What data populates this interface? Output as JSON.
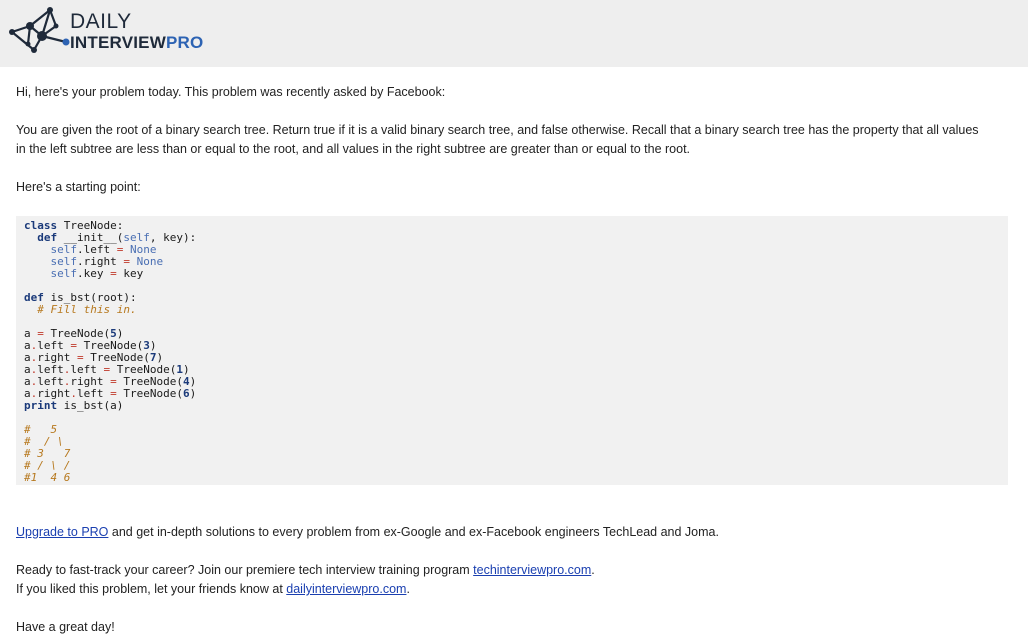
{
  "logo": {
    "line1": "DAILY",
    "line2_a": "INTERVIEW",
    "line2_b": "PRO"
  },
  "email": {
    "greeting": "Hi, here's your problem today. This problem was recently asked by Facebook:",
    "problem": "You are given the root of a binary search tree. Return true if it is a valid binary search tree, and false otherwise. Recall that a binary search tree has the property that all values in the left subtree are less than or equal to the root, and all values in the right subtree are greater than or equal to the root.",
    "starting_point": "Here's a starting point:",
    "upgrade_link": "Upgrade to PRO",
    "upgrade_text": " and get in-depth solutions to every problem from ex-Google and ex-Facebook engineers TechLead and Joma.",
    "ready_text": "Ready to fast-track your career? Join our premiere tech interview training program ",
    "ready_link": "techinterviewpro.com",
    "ready_end": ".",
    "liked_text": "If you liked this problem, let your friends know at ",
    "liked_link": "dailyinterviewpro.com",
    "liked_end": ".",
    "signoff": "Have a great day!"
  },
  "code": {
    "l1_kw": "class",
    "l1_rest": " TreeNode:",
    "l2_kw": "def",
    "l2_rest_a": " __init__(",
    "l2_self": "self",
    "l2_rest_b": ", key):",
    "l3_self": "self",
    "l3_a": ".left ",
    "l3_op": "=",
    "l3_none": " None",
    "l4_self": "self",
    "l4_a": ".right ",
    "l4_op": "=",
    "l4_none": " None",
    "l5_self": "self",
    "l5_a": ".key ",
    "l5_op": "=",
    "l5_b": " key",
    "l6_kw": "def",
    "l6_rest": " is_bst(root):",
    "l7_cm": "# Fill this in.",
    "l8_a": "a ",
    "l8_op": "=",
    "l8_b": " TreeNode(",
    "l8_n": "5",
    "l8_c": ")",
    "l9_a": "a",
    "l9_op1": ".",
    "l9_b": "left ",
    "l9_op": "=",
    "l9_c": " TreeNode(",
    "l9_n": "3",
    "l9_d": ")",
    "l10_a": "a",
    "l10_op1": ".",
    "l10_b": "right ",
    "l10_op": "=",
    "l10_c": " TreeNode(",
    "l10_n": "7",
    "l10_d": ")",
    "l11_a": "a",
    "l11_op1": ".",
    "l11_b": "left",
    "l11_op2": ".",
    "l11_c": "left ",
    "l11_op": "=",
    "l11_d": " TreeNode(",
    "l11_n": "1",
    "l11_e": ")",
    "l12_a": "a",
    "l12_op1": ".",
    "l12_b": "left",
    "l12_op2": ".",
    "l12_c": "right ",
    "l12_op": "=",
    "l12_d": " TreeNode(",
    "l12_n": "4",
    "l12_e": ")",
    "l13_a": "a",
    "l13_op1": ".",
    "l13_b": "right",
    "l13_op2": ".",
    "l13_c": "left ",
    "l13_op": "=",
    "l13_d": " TreeNode(",
    "l13_n": "6",
    "l13_e": ")",
    "l14_kw": "print",
    "l14_rest": " is_bst(a)",
    "c1": "#   5",
    "c2": "#  / \\",
    "c3": "# 3   7",
    "c4": "# / \\ /",
    "c5": "#1  4 6"
  }
}
